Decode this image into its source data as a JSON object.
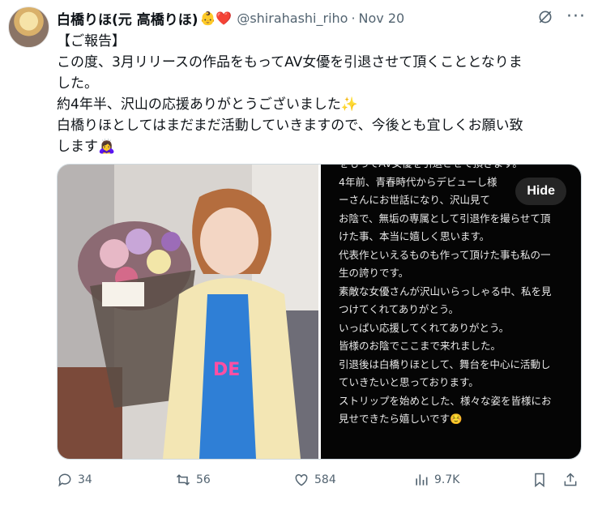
{
  "post": {
    "display_name": "白橋りほ(元 高橋りほ)",
    "name_emojis": "👶❤️",
    "handle": "@shirahashi_riho",
    "separator": "·",
    "date": "Nov 20",
    "lines": [
      "【ご報告】",
      "この度、3月リリースの作品をもってAV女優を引退させて頂くこととなりま",
      "した。",
      "約4年半、沢山の応援ありがとうございました✨",
      "白橋りほとしてはまだまだ活動していきますので、今後とも宜しくお願い致",
      "します🙇‍♀️"
    ]
  },
  "media": {
    "hide_label": "Hide",
    "image_text_lines": [
      "をもってAV女優を引退させて頂きます。",
      "4年前、青春時代からデビューし様",
      "ーさんにお世話になり、沢山見て",
      "お陰で、無垢の専属として引退作を撮らせて頂",
      "けた事、本当に嬉しく思います。",
      "代表作といえるものも作って頂けた事も私の一",
      "生の誇りです。",
      "",
      "素敵な女優さんが沢山いらっしゃる中、私を見",
      "つけてくれてありがとう。",
      "いっぱい応援してくれてありがとう。",
      "皆様のお陰でここまで来れました。",
      "",
      "引退後は白橋りほとして、舞台を中心に活動し",
      "ていきたいと思っております。",
      "ストリップを始めとした、様々な姿を皆様にお",
      "見せできたら嬉しいです☺️"
    ]
  },
  "actions": {
    "replies": "34",
    "reposts": "56",
    "likes": "584",
    "views": "9.7K"
  },
  "icons": [
    "avatar",
    "grok-icon",
    "more-icon",
    "reply-icon",
    "repost-icon",
    "like-icon",
    "views-icon",
    "bookmark-icon",
    "share-icon"
  ],
  "colors": {
    "text": "#0f1419",
    "secondary": "#536471",
    "border": "#cfd9de"
  }
}
